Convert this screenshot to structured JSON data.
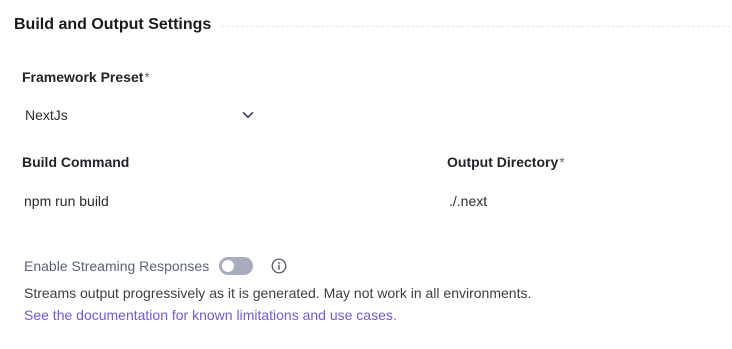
{
  "section": {
    "title": "Build and Output Settings"
  },
  "framework": {
    "label": "Framework Preset",
    "required_mark": "*",
    "selected": "NextJs"
  },
  "build_command": {
    "label": "Build Command",
    "value": "npm run build"
  },
  "output_directory": {
    "label": "Output Directory",
    "required_mark": "*",
    "value": "./.next"
  },
  "streaming": {
    "label": "Enable Streaming Responses",
    "enabled": false,
    "help_text": "Streams output progressively as it is generated. May not work in all environments.",
    "link_text": "See the documentation for known limitations and use cases."
  },
  "colors": {
    "link": "#6e5bd6",
    "toggle_off": "#a7adbc",
    "muted_label": "#5a6379"
  },
  "icons": {
    "select": "chevron-down-icon",
    "info": "info-icon"
  }
}
